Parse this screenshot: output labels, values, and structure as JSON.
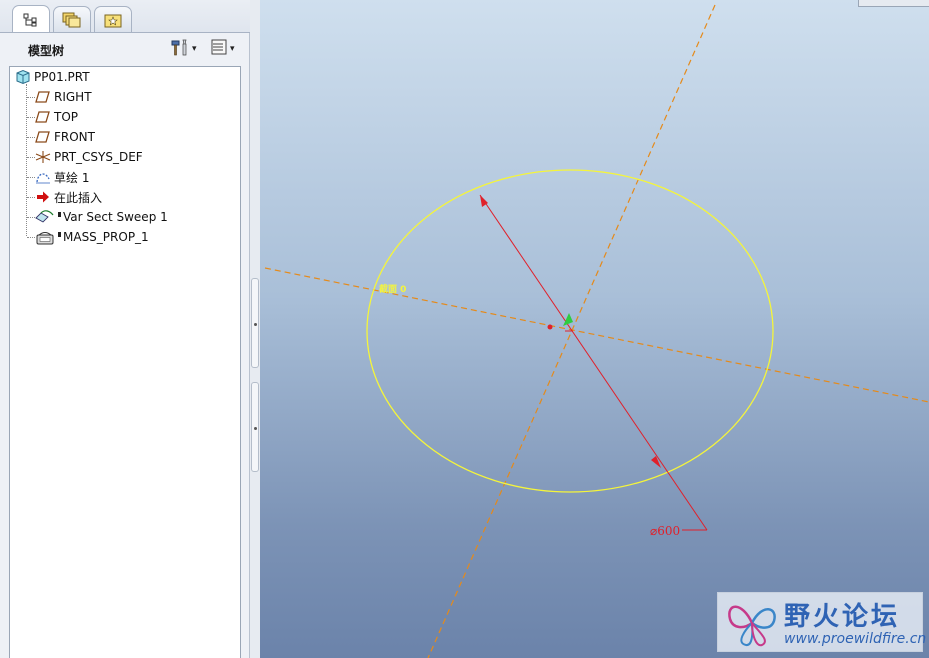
{
  "tabs": [
    {
      "name": "model-tree-tab",
      "icon": "tree-structure-icon",
      "active": true
    },
    {
      "name": "folder-browser-tab",
      "icon": "layered-folders-icon",
      "active": false
    },
    {
      "name": "favorites-tab",
      "icon": "star-folder-icon",
      "active": false
    }
  ],
  "panel": {
    "title": "模型树",
    "settings_icon": "hammer-tools-icon",
    "show_icon": "list-columns-icon",
    "dropdown_glyph": "▾"
  },
  "tree": {
    "root": {
      "label": "PP01.PRT",
      "icon": "part-cube-icon"
    },
    "items": [
      {
        "label": "RIGHT",
        "icon": "datum-plane-icon"
      },
      {
        "label": "TOP",
        "icon": "datum-plane-icon"
      },
      {
        "label": "FRONT",
        "icon": "datum-plane-icon"
      },
      {
        "label": "PRT_CSYS_DEF",
        "icon": "coordinate-system-icon"
      },
      {
        "label": "草绘 1",
        "icon": "sketch-icon"
      },
      {
        "label": "在此插入",
        "icon": "insert-here-arrow-icon"
      },
      {
        "label": "Var Sect Sweep 1",
        "icon": "sweep-feature-icon"
      },
      {
        "label": "MASS_PROP_1",
        "icon": "mass-properties-icon"
      }
    ]
  },
  "graphics": {
    "section_label": "截面 0",
    "dimension_label": "⌀600",
    "colors": {
      "sketch": "#f5f53a",
      "datum_axis": "#e58a1a",
      "dimension": "#e0202a",
      "start_point": "#2ecc40"
    }
  },
  "watermark": {
    "title": "野火论坛",
    "url": "www.proewildfire.cn"
  }
}
